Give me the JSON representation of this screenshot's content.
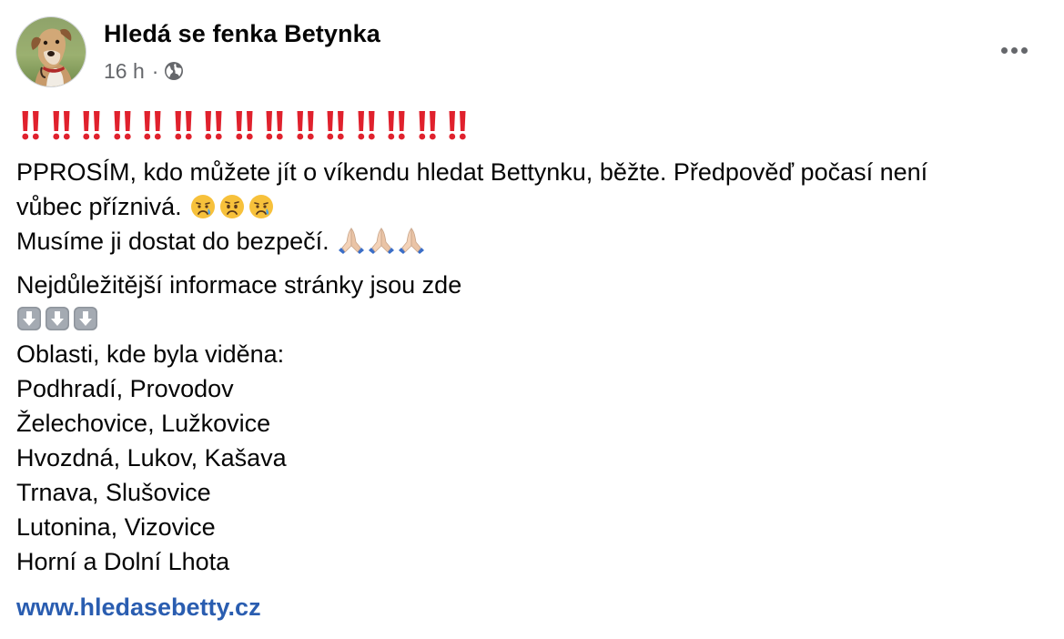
{
  "post": {
    "author": "Hledá se fenka Betynka",
    "time": "16 h",
    "separator": "·",
    "audience_icon": "globe-icon",
    "more_icon": "more-options-icon",
    "alert_icon": "double-exclamation-icon",
    "alert_count": 15,
    "lines_block1": [
      "PPROSÍM, kdo můžete jít o víkendu hledat Bettynku, běžte. Předpověď počasí není",
      "vůbec příznivá.",
      "Musíme ji dostat do bezpečí."
    ],
    "crying_emoji": "crying-face-icon",
    "sad_emoji": "sad-tear-face-icon",
    "praying_emoji": "folded-hands-icon",
    "info_heading": "Nejdůležitější informace stránky jsou zde",
    "down_arrow_icon": "down-arrow-icon",
    "areas_heading": "Oblasti, kde byla viděna:",
    "areas": [
      "Podhradí, Provodov",
      "Želechovice, Lužkovice",
      "Hvozdná, Lukov, Kašava",
      "Trnava, Slušovice",
      "Lutonina, Vizovice",
      "Horní a Dolní Lhota"
    ],
    "link": "www.hledasebetty.cz"
  },
  "colors": {
    "text": "#050505",
    "meta": "#65676b",
    "link": "#2a5db0",
    "alert": "#e0212d"
  }
}
